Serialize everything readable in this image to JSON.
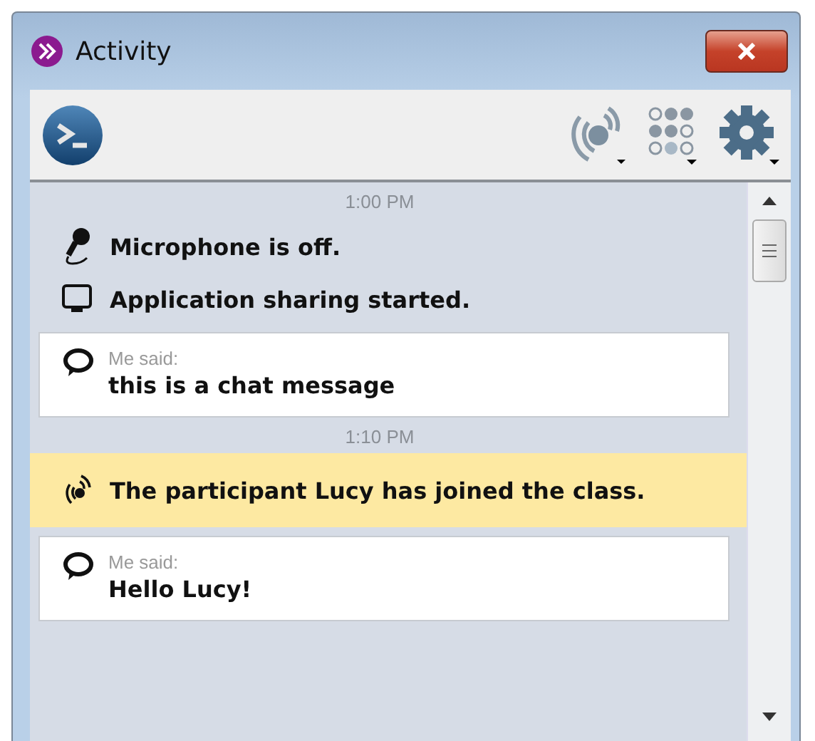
{
  "window": {
    "title": "Activity"
  },
  "feed": [
    {
      "kind": "time",
      "text": "1:00 PM"
    },
    {
      "kind": "microphone",
      "text": "Microphone is off."
    },
    {
      "kind": "screen",
      "text": "Application sharing started."
    },
    {
      "kind": "chat",
      "sender": "Me said:",
      "text": "this is a chat message"
    },
    {
      "kind": "time",
      "text": "1:10 PM"
    },
    {
      "kind": "join",
      "text": "The participant Lucy has joined the class."
    },
    {
      "kind": "chat",
      "sender": "Me said:",
      "text": "Hello Lucy!"
    }
  ]
}
